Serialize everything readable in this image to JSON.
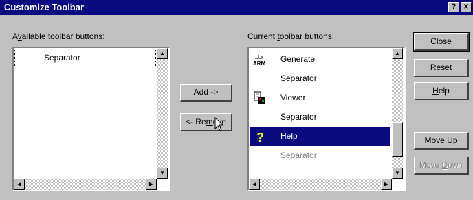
{
  "dialog": {
    "title": "Customize Toolbar",
    "help_button": "?",
    "close_button": "✕"
  },
  "available": {
    "label_pre": "A",
    "label_u": "v",
    "label_post": "ailable toolbar buttons:",
    "items": [
      {
        "label": "Separator",
        "selected": true
      }
    ]
  },
  "current": {
    "label_pre": "Current ",
    "label_u": "t",
    "label_post": "oolbar buttons:",
    "items": [
      {
        "label": "Generate",
        "icon": "arm-generate-icon"
      },
      {
        "label": "Separator",
        "icon": ""
      },
      {
        "label": "Viewer",
        "icon": "viewer-icon"
      },
      {
        "label": "Separator",
        "icon": ""
      },
      {
        "label": "Help",
        "icon": "question-mark-icon",
        "selected": true
      },
      {
        "label": "Separator",
        "icon": "",
        "dimmed": true
      }
    ]
  },
  "buttons": {
    "add": {
      "u": "A",
      "rest": "dd ->"
    },
    "remove": {
      "pre": "<- Re",
      "u": "m",
      "rest": "ove"
    },
    "close": {
      "u": "C",
      "rest": "lose"
    },
    "reset": {
      "pre": "R",
      "u": "e",
      "rest": "set"
    },
    "help": {
      "u": "H",
      "rest": "elp"
    },
    "move_up": {
      "pre": "Move ",
      "u": "U",
      "rest": "p"
    },
    "move_down": {
      "pre": "Move ",
      "u": "D",
      "rest": "own"
    }
  },
  "colors": {
    "title_bg": "#0a0a80",
    "face": "#c0c0c0",
    "selection": "#0a0a80"
  }
}
